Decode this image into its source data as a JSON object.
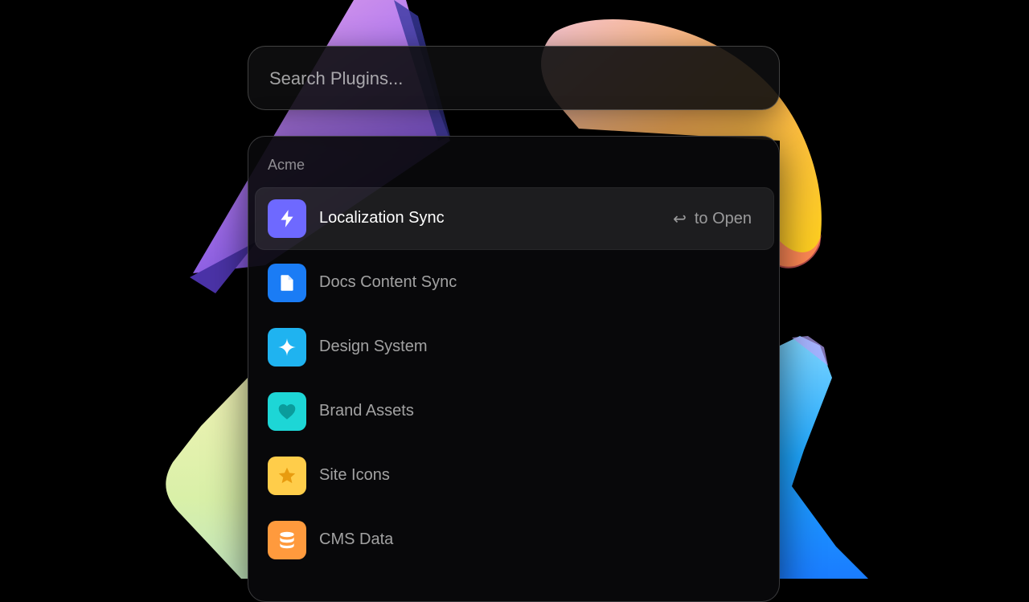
{
  "search": {
    "placeholder": "Search Plugins...",
    "value": ""
  },
  "group": {
    "label": "Acme"
  },
  "items": [
    {
      "label": "Localization Sync",
      "icon": "lightning-icon",
      "color": "#6e69ff",
      "selected": true,
      "hint": "to Open"
    },
    {
      "label": "Docs Content Sync",
      "icon": "document-icon",
      "color": "#1a7cf5"
    },
    {
      "label": "Design System",
      "icon": "sparkle-icon",
      "color": "#1fb3f0"
    },
    {
      "label": "Brand Assets",
      "icon": "heart-icon",
      "color": "#1dd6d6"
    },
    {
      "label": "Site Icons",
      "icon": "star-icon",
      "color": "#ffcd4a"
    },
    {
      "label": "CMS Data",
      "icon": "database-icon",
      "color": "#ff9a3d"
    }
  ],
  "hint_icon": "return-icon",
  "hint_symbol": "↩"
}
